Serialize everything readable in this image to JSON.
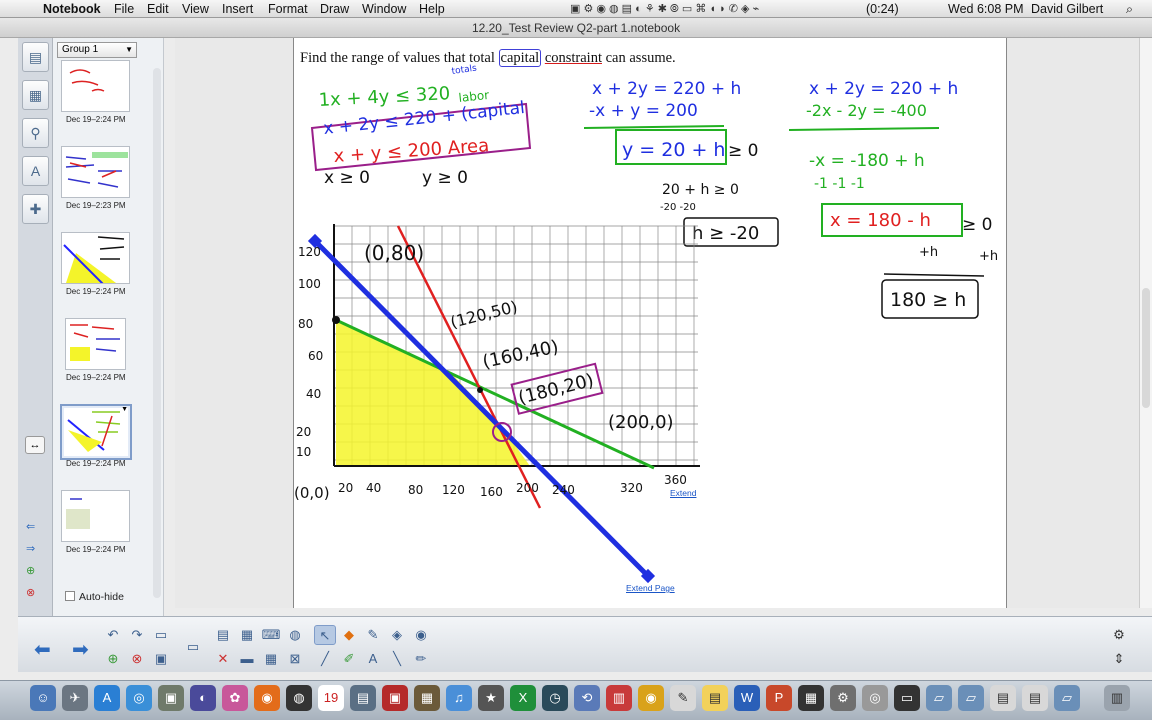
{
  "menubar": {
    "app_name": "Notebook",
    "menus": [
      "File",
      "Edit",
      "View",
      "Insert",
      "Format",
      "Draw",
      "Window",
      "Help"
    ],
    "battery": "(0:24)",
    "clock": "Wed 6:08 PM",
    "user": "David Gilbert"
  },
  "window": {
    "title": "12.20_Test Review Q2-part 1.notebook"
  },
  "sorter": {
    "group": "Group 1",
    "thumbnails": [
      {
        "date": "Dec 19–2:24 PM"
      },
      {
        "date": "Dec 19–2:23 PM"
      },
      {
        "date": "Dec 19–2:24 PM"
      },
      {
        "date": "Dec 19–2:24 PM"
      },
      {
        "date": "Dec 19–2:24 PM"
      },
      {
        "date": "Dec 19–2:24 PM"
      }
    ],
    "auto_hide": "Auto-hide"
  },
  "page": {
    "question_pre": "Find the range of values that total ",
    "question_boxed": "capital",
    "question_underlined": "constraint",
    "question_post": " can assume.",
    "handwriting": {
      "totals": "totals",
      "labor": "labor",
      "c1": "1x + 4y ≤ 320",
      "c2": "x + 2y ≤ 220 + (capital",
      "c3": "x + y ≤ 200 Area",
      "nonneg_x": "x ≥ 0",
      "nonneg_y": "y ≥ 0",
      "sys1a": "x + 2y = 220 + h",
      "sys1b": "-x + y = 200",
      "sys1c": "y = 20 + h",
      "geq0": "≥ 0",
      "step1": "20 + h ≥ 0",
      "step1b": "-20       -20",
      "res1": "h ≥ -20",
      "sys2a": "x + 2y = 220 + h",
      "sys2b": "-2x - 2y = -400",
      "step2a": "-x   =  -180 + h",
      "step2b": "-1        -1     -1",
      "res2": "x = 180 - h",
      "res2geq": "≥ 0",
      "plus_h1": "+h",
      "plus_h2": "+h",
      "res3": "180 ≥ h",
      "pt1": "(0,80)",
      "pt2": "(120,50)",
      "pt3": "(160,40)",
      "pt4": "(180,20)",
      "pt5": "(200,0)",
      "pt0": "(0,0)",
      "xticks": [
        "20",
        "40",
        "80",
        "120",
        "160",
        "200",
        "240",
        "320",
        "360"
      ],
      "yticks": [
        "120",
        "100",
        "80",
        "60",
        "40",
        "20",
        "10"
      ]
    },
    "extend_link": "Extend",
    "extend_page_link": "Extend Page"
  },
  "colors": {
    "blue_ink": "#1f2fe0",
    "red_ink": "#e02020",
    "green_ink": "#22b022",
    "purple_ink": "#9a1f8a",
    "black_ink": "#111111",
    "highlight": "#f4f42a"
  }
}
